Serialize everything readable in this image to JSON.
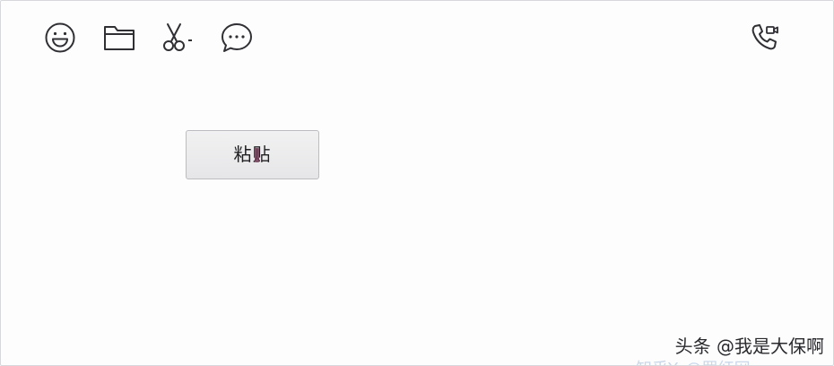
{
  "toolbar": {
    "icons": [
      {
        "name": "emoji-icon",
        "label": "emoji"
      },
      {
        "name": "folder-icon",
        "label": "file"
      },
      {
        "name": "scissors-icon",
        "label": "screenshot"
      },
      {
        "name": "chat-bubble-icon",
        "label": "chat-history"
      },
      {
        "name": "video-call-icon",
        "label": "call"
      }
    ]
  },
  "context_menu": {
    "paste_label": "粘贴"
  },
  "watermark": {
    "text": "头条 @我是大保啊",
    "secondary_text": "知乎Yo@罗红网"
  },
  "colors": {
    "background": "#fdfdfe",
    "icon_stroke": "#2f2f34",
    "button_border": "#bdbdc1",
    "button_fill": "#ececee"
  }
}
